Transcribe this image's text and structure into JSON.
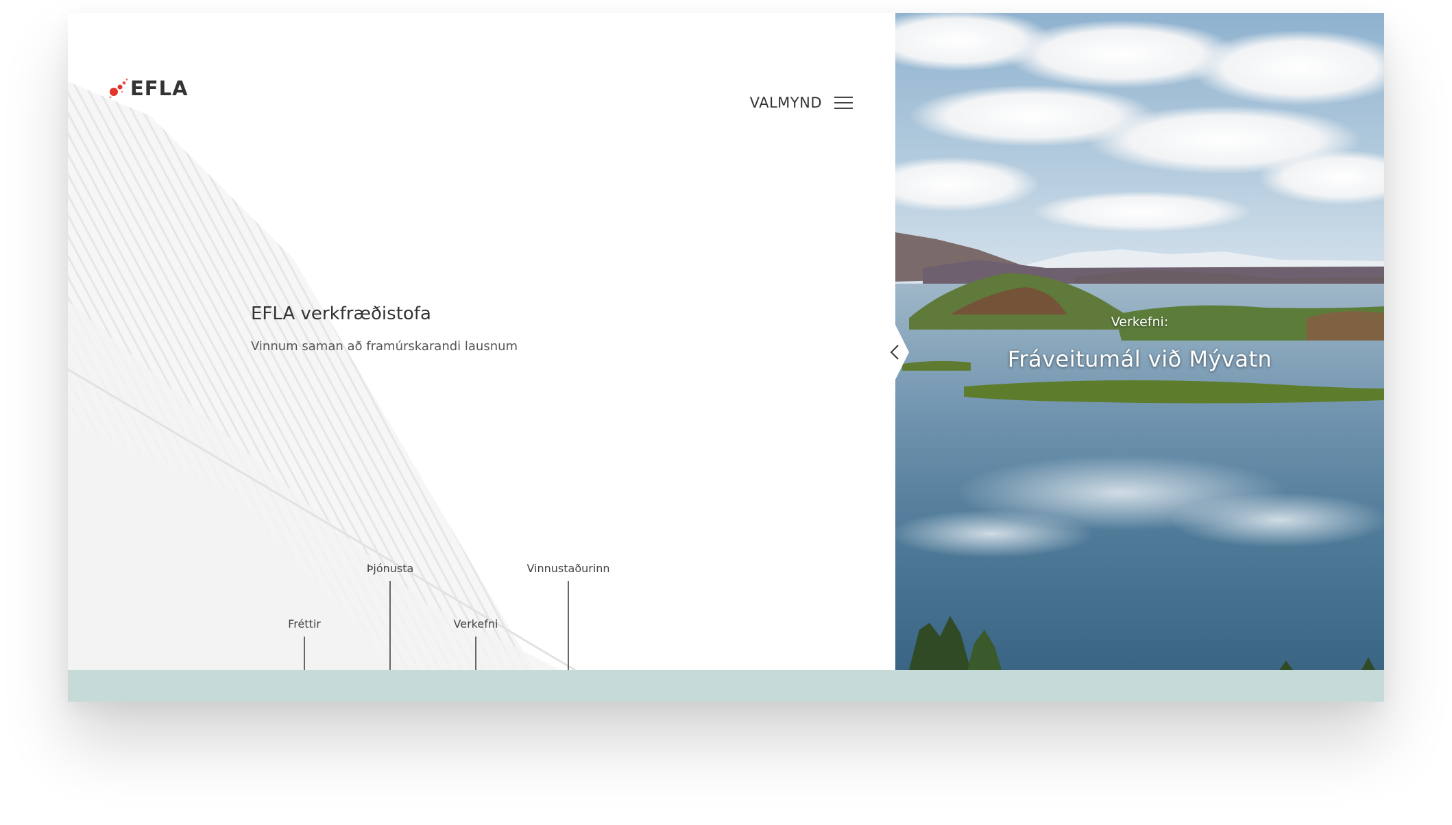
{
  "brand": {
    "name": "EFLA",
    "logo_color": "#e0352b"
  },
  "menu": {
    "label": "VALMYND",
    "icon": "hamburger-icon"
  },
  "hero": {
    "title": "EFLA verkfræðistofa",
    "subtitle": "Vinnum saman að framúrskarandi lausnum"
  },
  "nav": [
    {
      "label": "Fréttir"
    },
    {
      "label": "Þjónusta"
    },
    {
      "label": "Verkefni"
    },
    {
      "label": "Vinnustaðurinn"
    }
  ],
  "project": {
    "kicker": "Verkefni:",
    "title": "Fráveitumál við Mývatn"
  },
  "slider": {
    "prev_icon": "chevron-left-icon"
  },
  "colors": {
    "footer_strip": "#c6dbd8",
    "text_dark": "#333333"
  }
}
